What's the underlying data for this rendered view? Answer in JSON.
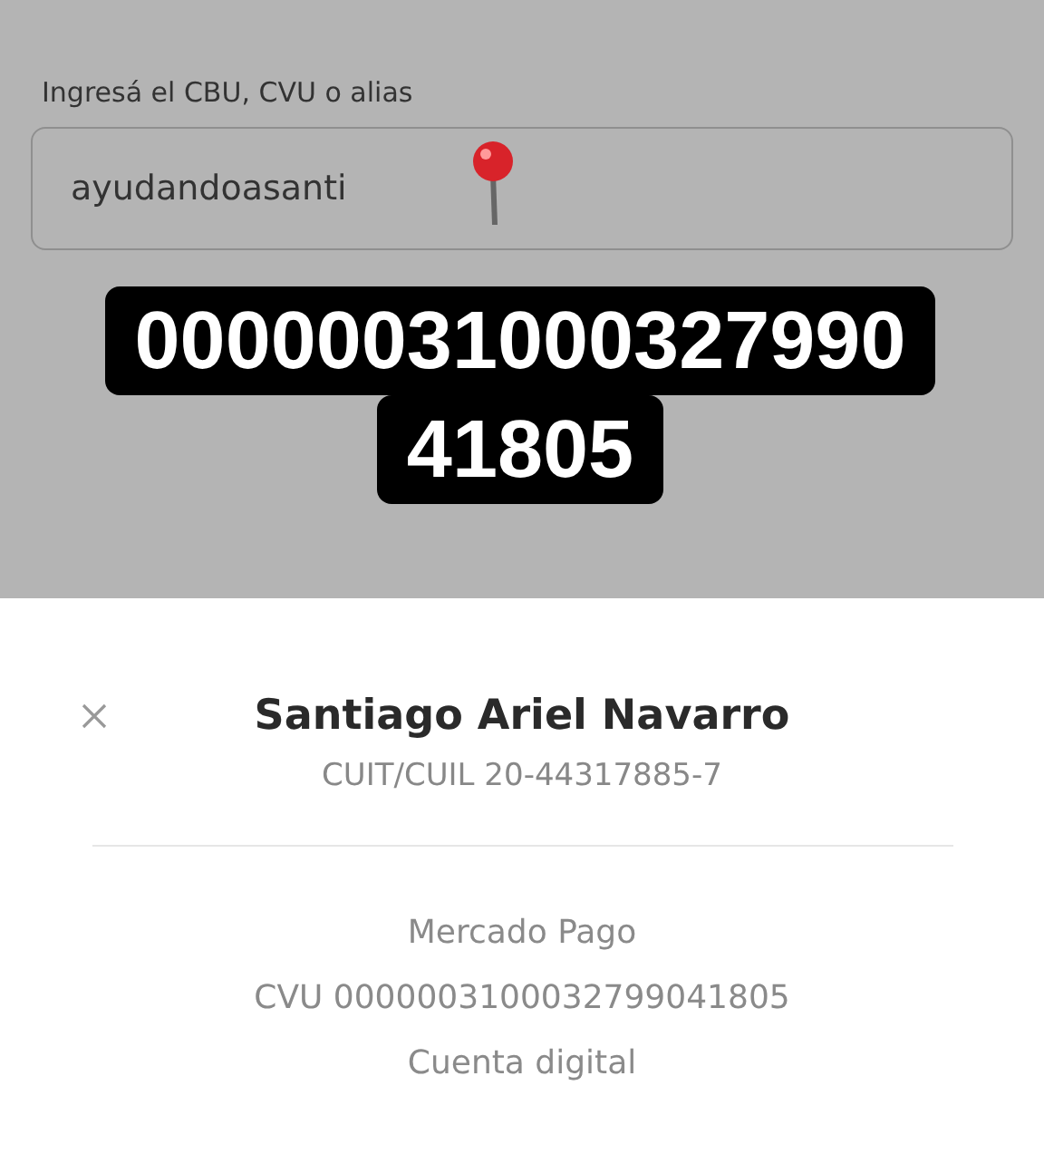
{
  "alias_label": "Ingresá el CBU, CVU o alias",
  "alias_field": {
    "value": "ayudandoasanti"
  },
  "overlay_lines": [
    "00000031000327990",
    "41805"
  ],
  "recipient": {
    "name": "Santiago Ariel Navarro",
    "tax_id": "CUIT/CUIL 20-44317885-7"
  },
  "account": {
    "bank": "Mercado Pago",
    "cvu": "CVU 0000003100032799041805",
    "type": "Cuenta digital"
  }
}
